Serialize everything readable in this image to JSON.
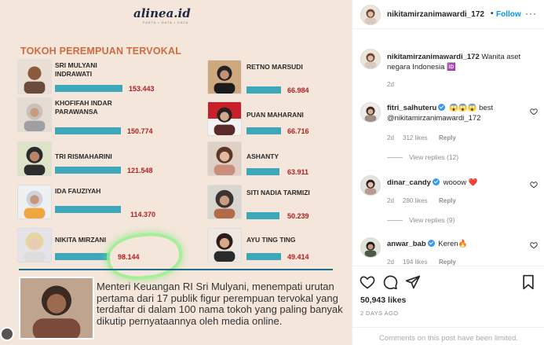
{
  "post": {
    "brand": "alinea.id",
    "brand_sub": "FAKTA • DATA • KATA",
    "title": "TOKOH PEREMPUAN TERVOKAL",
    "entries": [
      {
        "name": "SRI MULYANI INDRAWATI",
        "value": "153.443"
      },
      {
        "name": "KHOFIFAH INDAR PARAWANSA",
        "value": "150.774"
      },
      {
        "name": "TRI RISMAHARINI",
        "value": "121.548"
      },
      {
        "name": "IDA FAUZIYAH",
        "value": "114.370"
      },
      {
        "name": "NIKITA MIRZANI",
        "value": "98.144"
      },
      {
        "name": "RETNO MARSUDI",
        "value": "66.984"
      },
      {
        "name": "PUAN MAHARANI",
        "value": "66.716"
      },
      {
        "name": "ASHANTY",
        "value": "63.911"
      },
      {
        "name": "SITI NADIA TARMIZI",
        "value": "50.239"
      },
      {
        "name": "AYU TING TING",
        "value": "49.414"
      }
    ],
    "caption": "Menteri Keuangan RI Sri Mulyani, menempati urutan pertama dari 17 publik figur perempuan tervokal yang terdaftar di dalam 100 nama tokoh yang paling banyak dikutip pernyataannya oleh media online."
  },
  "header": {
    "username": "nikitamirzanimawardi_172",
    "separator": "•",
    "follow": "Follow",
    "more": "···"
  },
  "owner_comment": {
    "username": "nikitamirzanimawardi_172",
    "text": "Wanita aset negara Indonesia 🆔",
    "time": "2d"
  },
  "comments": [
    {
      "username": "fitri_salhuteru",
      "text": "😱😱😱 best @nikitamirzanimawardi_172",
      "time": "2d",
      "likes": "312 likes",
      "reply": "Reply",
      "view_replies": "View replies (12)"
    },
    {
      "username": "dinar_candy",
      "text": "wooow ❤️",
      "time": "2d",
      "likes": "280 likes",
      "reply": "Reply",
      "view_replies": "View replies (9)"
    },
    {
      "username": "anwar_bab",
      "text": "Keren🔥",
      "time": "2d",
      "likes": "194 likes",
      "reply": "Reply"
    }
  ],
  "footer": {
    "likes": "50,943 likes",
    "ago": "2 DAYS AGO",
    "limited": "Comments on this post have been limited."
  },
  "icons": {
    "like": "heart-icon",
    "comment": "comment-icon",
    "share": "share-icon",
    "save": "bookmark-icon"
  }
}
